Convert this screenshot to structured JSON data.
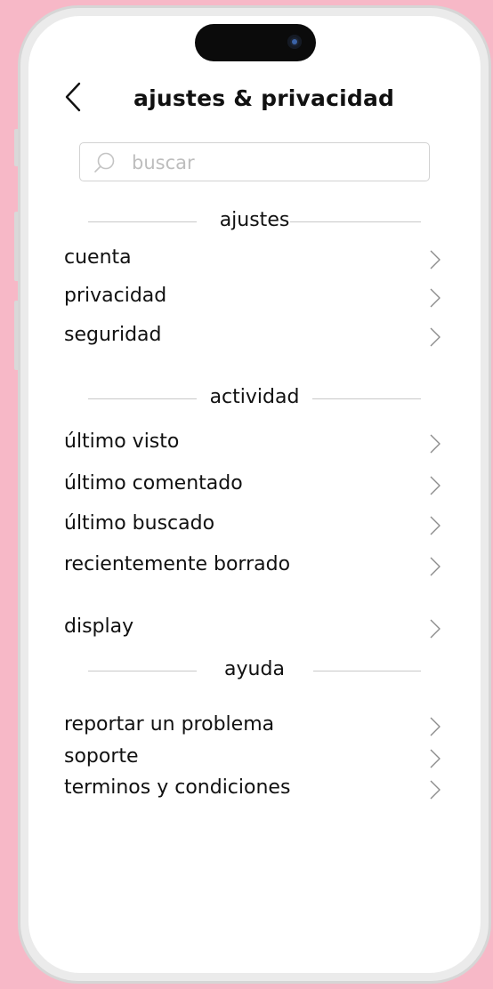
{
  "header": {
    "title": "ajustes & privacidad"
  },
  "search": {
    "placeholder": "buscar"
  },
  "sections": {
    "ajustes": "ajustes",
    "actividad": "actividad",
    "ayuda": "ayuda"
  },
  "items": {
    "cuenta": "cuenta",
    "privacidad": "privacidad",
    "seguridad": "seguridad",
    "ultimo_visto": "último visto",
    "ultimo_comentado": "último comentado",
    "ultimo_buscado": "último buscado",
    "recientemente_borrado": "recientemente borrado",
    "display": "display",
    "reportar": "reportar un problema",
    "soporte": "soporte",
    "terminos": "terminos y condiciones"
  },
  "icons": {
    "back": "chevron-left-icon",
    "search": "search-icon",
    "row_arrow": "chevron-right-icon",
    "camera": "camera-icon"
  },
  "colors": {
    "background": "#f7b8c7",
    "phone_frame": "#ebebeb",
    "screen": "#ffffff",
    "text": "#111111",
    "placeholder": "#bdbdbd",
    "divider": "#c8c8c8"
  }
}
